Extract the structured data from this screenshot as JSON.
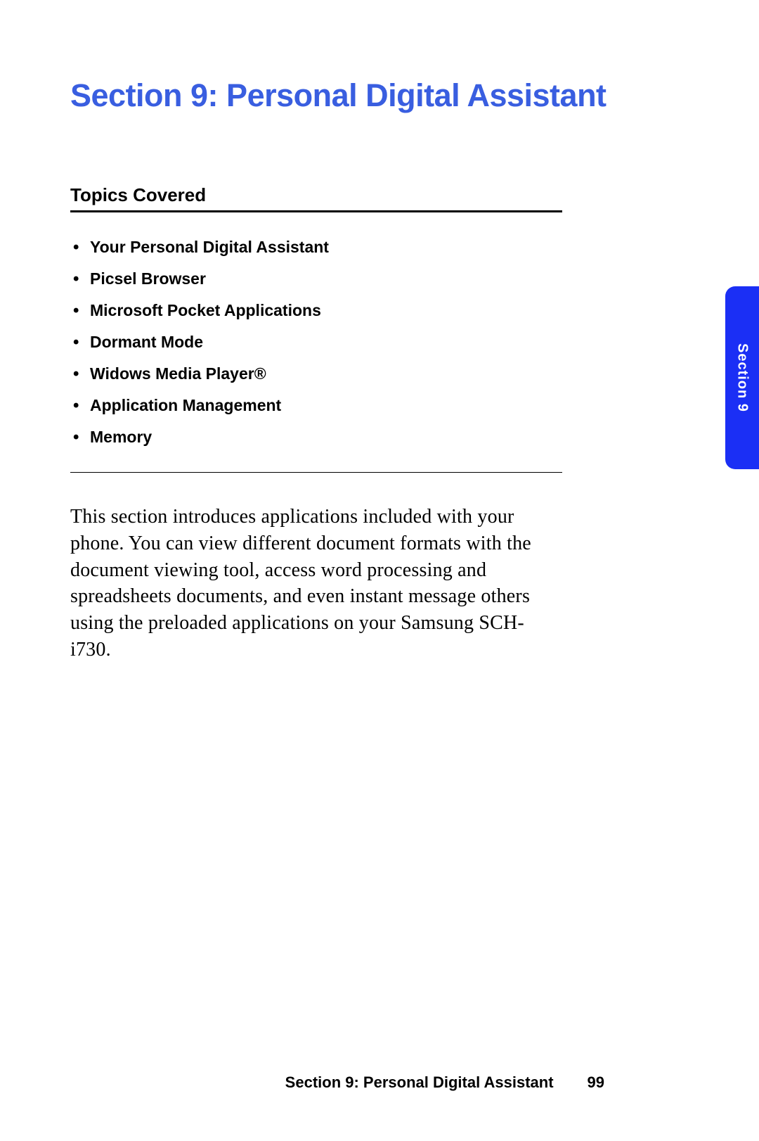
{
  "heading": "Section 9: Personal Digital Assistant",
  "topics_heading": "Topics Covered",
  "topics": [
    "Your Personal Digital Assistant",
    "Picsel Browser",
    "Microsoft Pocket Applications",
    "Dormant Mode",
    "Widows Media Player®",
    "Application Management",
    "Memory"
  ],
  "body": "This section introduces applications included with your phone. You can view different document formats with the document viewing tool, access word processing and spreadsheets documents, and even instant message others using the preloaded applications on your Samsung SCH-i730.",
  "side_tab": "Section 9",
  "footer": {
    "title": "Section 9: Personal Digital Assistant",
    "page": "99"
  }
}
